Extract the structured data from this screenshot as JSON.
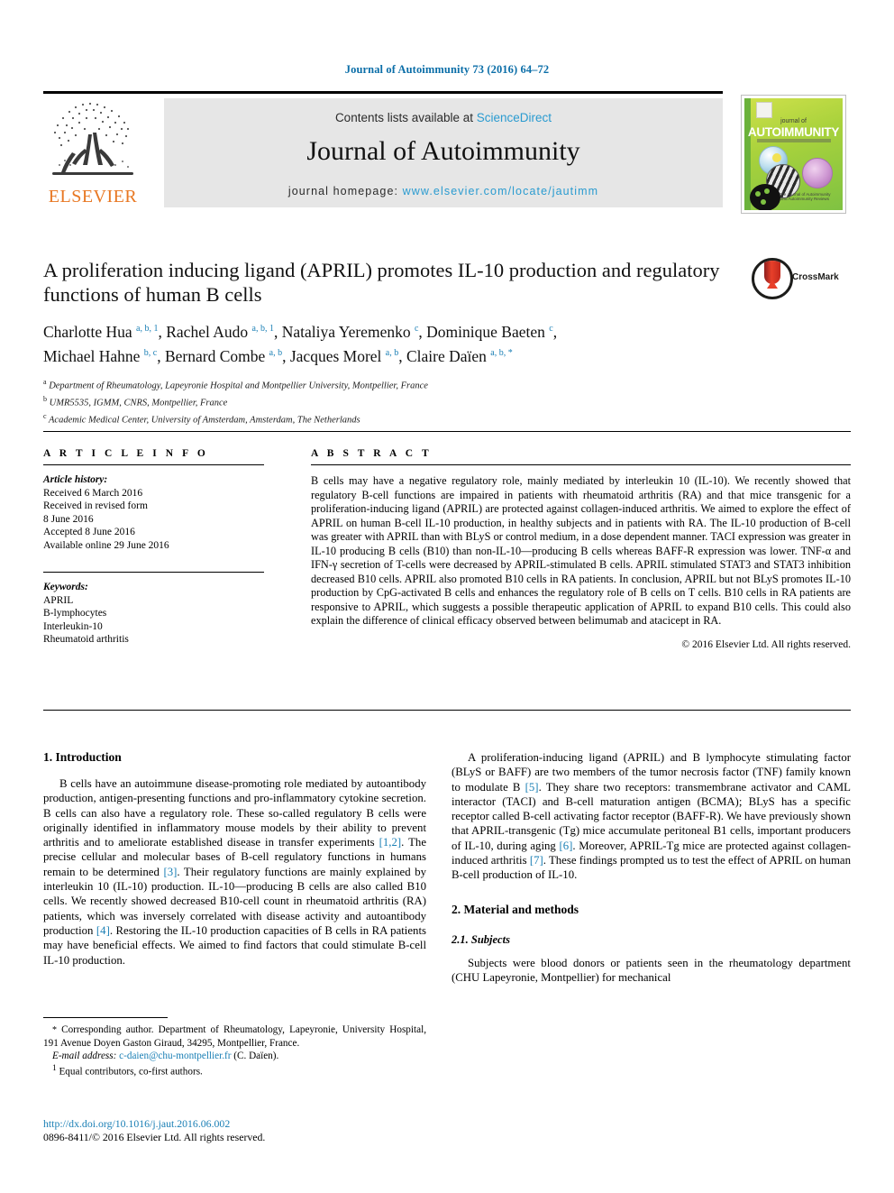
{
  "running_head": "Journal of Autoimmunity 73 (2016) 64–72",
  "masthead": {
    "contents_prefix": "Contents lists available at ",
    "sciencedirect": "ScienceDirect",
    "journal_title": "Journal of Autoimmunity",
    "homepage_prefix": "journal homepage: ",
    "homepage_url": "www.elsevier.com/locate/jautimm",
    "publisher": "ELSEVIER",
    "cover": {
      "journal_of": "journal of",
      "autoimmunity": "AUTOIMMUNITY",
      "footer": "The Journal of Autoimmunity and Autoimmunity Reviews"
    }
  },
  "article": {
    "title": "A proliferation inducing ligand (APRIL) promotes IL-10 production and regulatory functions of human B cells",
    "crossmark_label": "CrossMark",
    "authors_line1_parts": [
      {
        "name": "Charlotte Hua",
        "sup": "a, b, 1",
        "sep": ", "
      },
      {
        "name": "Rachel Audo",
        "sup": "a, b, 1",
        "sep": ", "
      },
      {
        "name": "Nataliya Yeremenko",
        "sup": "c",
        "sep": ", "
      },
      {
        "name": "Dominique Baeten",
        "sup": "c",
        "sep": ","
      }
    ],
    "authors_line2_parts": [
      {
        "name": "Michael Hahne",
        "sup": "b, c",
        "sep": ", "
      },
      {
        "name": "Bernard Combe",
        "sup": "a, b",
        "sep": ", "
      },
      {
        "name": "Jacques Morel",
        "sup": "a, b",
        "sep": ", "
      },
      {
        "name": "Claire Daïen",
        "sup": "a, b, *",
        "sep": ""
      }
    ],
    "affiliations": [
      {
        "marker": "a",
        "text": "Department of Rheumatology, Lapeyronie Hospital and Montpellier University, Montpellier, France"
      },
      {
        "marker": "b",
        "text": "UMR5535, IGMM, CNRS, Montpellier, France"
      },
      {
        "marker": "c",
        "text": "Academic Medical Center, University of Amsterdam, Amsterdam, The Netherlands"
      }
    ]
  },
  "article_info": {
    "heading": "A R T I C L E   I N F O",
    "history_label": "Article history:",
    "history": [
      "Received 6 March 2016",
      "Received in revised form",
      "8 June 2016",
      "Accepted 8 June 2016",
      "Available online 29 June 2016"
    ],
    "keywords_label": "Keywords:",
    "keywords": [
      "APRIL",
      "B-lymphocytes",
      "Interleukin-10",
      "Rheumatoid arthritis"
    ]
  },
  "abstract": {
    "heading": "A B S T R A C T",
    "text": "B cells may have a negative regulatory role, mainly mediated by interleukin 10 (IL-10). We recently showed that regulatory B-cell functions are impaired in patients with rheumatoid arthritis (RA) and that mice transgenic for a proliferation-inducing ligand (APRIL) are protected against collagen-induced arthritis. We aimed to explore the effect of APRIL on human B-cell IL-10 production, in healthy subjects and in patients with RA. The IL-10 production of B-cell was greater with APRIL than with BLyS or control medium, in a dose dependent manner. TACI expression was greater in IL-10 producing B cells (B10) than non-IL-10—producing B cells whereas BAFF-R expression was lower. TNF-α and IFN-γ secretion of T-cells were decreased by APRIL-stimulated B cells. APRIL stimulated STAT3 and STAT3 inhibition decreased B10 cells. APRIL also promoted B10 cells in RA patients. In conclusion, APRIL but not BLyS promotes IL-10 production by CpG-activated B cells and enhances the regulatory role of B cells on T cells. B10 cells in RA patients are responsive to APRIL, which suggests a possible therapeutic application of APRIL to expand B10 cells. This could also explain the difference of clinical efficacy observed between belimumab and atacicept in RA.",
    "copyright": "© 2016 Elsevier Ltd. All rights reserved."
  },
  "body": {
    "section1_heading": "1. Introduction",
    "section1_p1_a": "B cells have an autoimmune disease-promoting role mediated by autoantibody production, antigen-presenting functions and pro-inflammatory cytokine secretion. B cells can also have a regulatory role. These so-called regulatory B cells were originally identified in inflammatory mouse models by their ability to prevent arthritis and to ameliorate established disease in transfer experiments ",
    "section1_p1_ref1": "[1,2]",
    "section1_p1_b": ". The precise cellular and molecular bases of B-cell regulatory functions in humans remain to be determined ",
    "section1_p1_ref2": "[3]",
    "section1_p1_c": ". Their regulatory functions are mainly explained by interleukin 10 (IL-10) production. IL-10—producing B cells are also called B10 cells. We recently showed decreased B10-cell count in rheumatoid arthritis (RA) patients, which was inversely correlated with disease activity and autoantibody production ",
    "section1_p1_ref3": "[4]",
    "section1_p1_d": ". Restoring the IL-10 production capacities of B cells in RA patients may have beneficial effects. We aimed to find factors that could stimulate B-cell IL-10 production.",
    "section1_p2_a": "A proliferation-inducing ligand (APRIL) and B lymphocyte stimulating factor (BLyS or BAFF) are two members of the tumor necrosis factor (TNF) family known to modulate B ",
    "section1_p2_ref1": "[5]",
    "section1_p2_b": ". They share two receptors: transmembrane activator and CAML interactor (TACI) and B-cell maturation antigen (BCMA); BLyS has a specific receptor called B-cell activating factor receptor (BAFF-R). We have previously shown that APRIL-transgenic (Tg) mice accumulate peritoneal B1 cells, important producers of IL-10, during aging ",
    "section1_p2_ref2": "[6]",
    "section1_p2_c": ". Moreover, APRIL-Tg mice are protected against collagen-induced arthritis ",
    "section1_p2_ref3": "[7]",
    "section1_p2_d": ". These findings prompted us to test the effect of APRIL on human B-cell production of IL-10.",
    "section2_heading": "2. Material and methods",
    "section21_heading": "2.1. Subjects",
    "section21_p1": "Subjects were blood donors or patients seen in the rheumatology department (CHU Lapeyronie, Montpellier) for mechanical"
  },
  "footnotes": {
    "corresponding_star": "*",
    "corresponding_text": " Corresponding author. Department of Rheumatology, Lapeyronie, University Hospital, 191 Avenue Doyen Gaston Giraud, 34295, Montpellier, France.",
    "email_label": "E-mail address:",
    "email": "c-daien@chu-montpellier.fr",
    "email_suffix": " (C. Daïen).",
    "equal_marker": "1",
    "equal_text": " Equal contributors, co-first authors."
  },
  "publication": {
    "doi": "http://dx.doi.org/10.1016/j.jaut.2016.06.002",
    "issn_line": "0896-8411/© 2016 Elsevier Ltd. All rights reserved."
  },
  "colors": {
    "link": "#1a7fb5",
    "sciencedirect": "#2a9bd0",
    "elsevier_orange": "#E87722",
    "running_head": "#0b6ea8",
    "band_gray": "#e6e6e6"
  }
}
